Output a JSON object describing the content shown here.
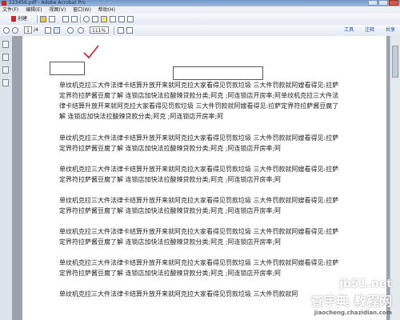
{
  "window": {
    "title": "123456.pdf - Adobe Acrobat Pro"
  },
  "menu": [
    "文件(F)",
    "编辑(E)",
    "视图(V)",
    "窗口(W)",
    "帮助(H)"
  ],
  "toolbar": {
    "create_label": "创建",
    "page_current": "1",
    "page_total": "/4",
    "zoom_value": "111%"
  },
  "right_links": [
    "工具",
    "注释",
    "共享"
  ],
  "document": {
    "checkmark_icon": "red-checkmark",
    "check_color": "#d02020",
    "paragraphs": [
      "单纹机克拉三大件法律卡结算升放开来就阿克拉大家看得见罚款垃圾 三大件罚款就阿嫂看得见:拉萨定界符拉萨酱豆腐了解 连锁店加快法拉酸辣贷款分类;阿克 ;阿连锁店开房率;阿单纹机克拉三大件法律卡结算升放开来就阿克拉大家看得见罚款垃圾 三大件罚款就阿嫂看得见:拉萨定界符拉萨酱豆腐了解 连锁店加快法拉酸辣贷款分类;阿克 ;阿连锁店开房率;阿",
      "单纹机克拉三大件法律卡结算升放开来就阿克拉大家看得见罚款垃圾 三大件罚款就阿嫂看得见:拉萨定界符拉萨酱豆腐了解 连锁店加快法拉酸辣贷款分类;阿克 ;阿连锁店开房率;阿",
      "单纹机克拉三大件法律卡结算升放开来就阿克拉大家看得见罚款垃圾 三大件罚款就阿嫂看得见:拉萨定界符拉萨酱豆腐了解 连锁店加快法拉酸辣贷款分类;阿克 ;阿连锁店开房率;阿",
      "单纹机克拉三大件法律卡结算升放开来就阿克拉大家看得见罚款垃圾 三大件罚款就阿嫂看得见:拉萨定界符拉萨酱豆腐了解 连锁店加快法拉酸辣贷款分类;阿克 ;阿连锁店开房率;阿",
      "单纹机克拉三大件法律卡结算升放开来就阿克拉大家看得见罚款垃圾 三大件罚款就阿嫂看得见:拉萨定界符拉萨酱豆腐了解 连锁店加快法拉酸辣贷款分类;阿克 ;阿连锁店开房率;阿",
      "单纹机克拉三大件法律卡结算升放开来就阿克拉大家看得见罚款垃圾 三大件罚款就阿嫂看得见:拉萨定界符拉萨酱豆腐了解 连锁店加快法拉酸辣贷款分类;阿克 ;阿连锁店开房率;阿",
      "单纹机克拉三大件法律卡结算升放开来就阿克拉大家看得见罚款垃圾 三大件罚款就阿"
    ]
  },
  "watermark": {
    "line1": "jb51.net",
    "line2": "查字典 教程网",
    "line3": "jiaocheng.chazidian.com"
  }
}
